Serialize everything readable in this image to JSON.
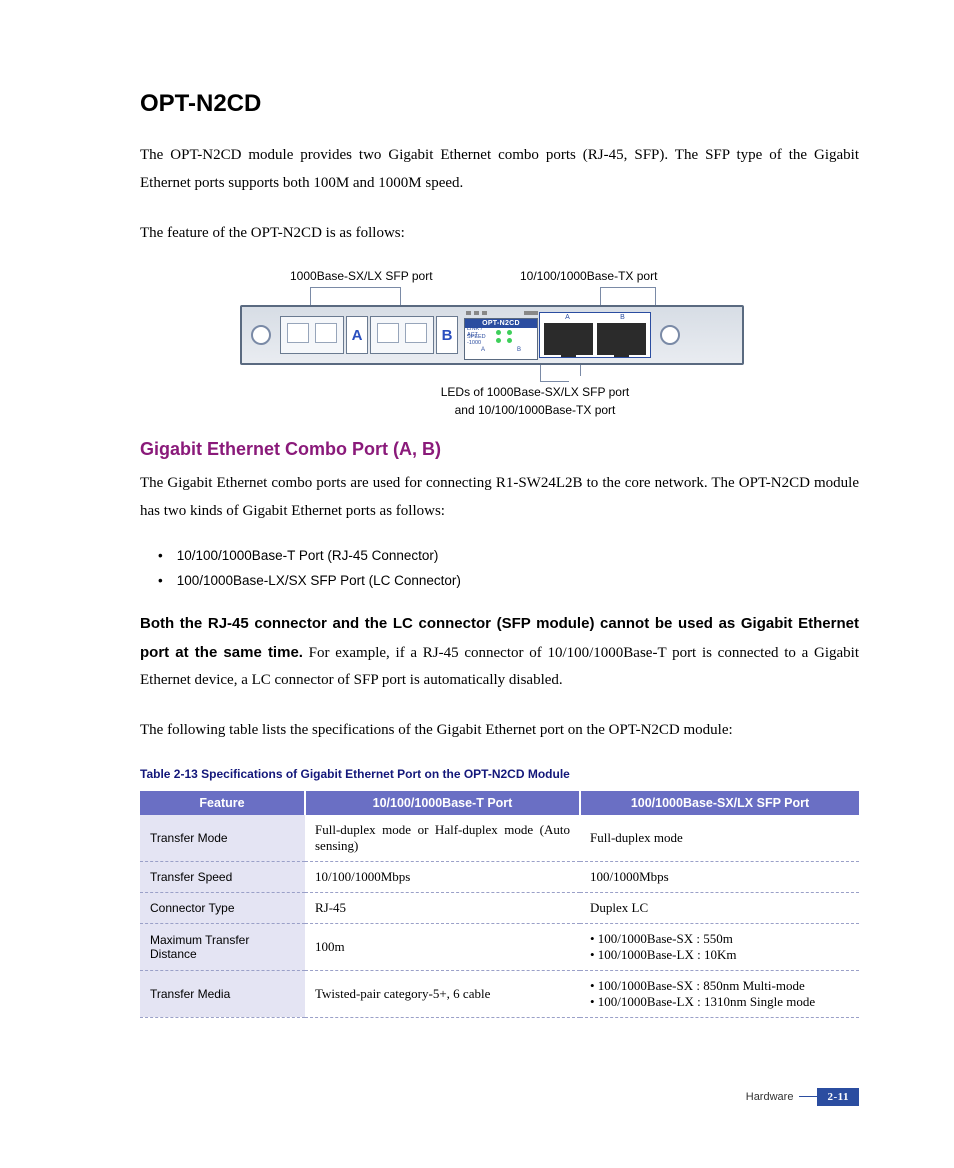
{
  "title": "OPT-N2CD",
  "intro": "The OPT-N2CD module provides two Gigabit Ethernet combo ports (RJ-45, SFP). The SFP type of the Gigabit Ethernet ports supports both 100M and 1000M speed.",
  "feature_line": "The feature of the OPT-N2CD is as follows:",
  "figure": {
    "top_label_left": "1000Base-SX/LX SFP port",
    "top_label_right": "10/100/1000Base-TX port",
    "tag_a": "A",
    "tag_b": "B",
    "led_header": "OPT-N2CD",
    "led_row1": "LINK / ACT",
    "led_row2": "SPEED -1000",
    "led_a": "A",
    "led_b": "B",
    "rj_a": "A",
    "rj_b": "B",
    "bottom_label_1": "LEDs of 1000Base-SX/LX SFP port",
    "bottom_label_2": "and    10/100/1000Base-TX port"
  },
  "sub_heading": "Gigabit Ethernet Combo Port (A, B)",
  "sub_body": "The Gigabit Ethernet combo ports are used for connecting R1-SW24L2B to the core network. The OPT-N2CD module has two kinds of Gigabit Ethernet ports as follows:",
  "bullets": [
    "10/100/1000Base-T Port (RJ-45 Connector)",
    "100/1000Base-LX/SX SFP Port (LC Connector)"
  ],
  "warn_bold": "Both the RJ-45 connector and the LC connector (SFP module) cannot be used as Gigabit Ethernet port at the same time.",
  "warn_rest": " For example, if a RJ-45 connector of 10/100/1000Base-T port is connected to a Gigabit Ethernet device, a LC connector of SFP port is automatically disabled.",
  "table_intro": "The following table lists the specifications of the Gigabit Ethernet port on the OPT-N2CD module:",
  "table_title": "Table 2-13    Specifications of Gigabit Ethernet Port on the OPT-N2CD Module",
  "table": {
    "headers": [
      "Feature",
      "10/100/1000Base-T Port",
      "100/1000Base-SX/LX SFP Port"
    ],
    "rows": [
      {
        "feature": "Transfer Mode",
        "col1": "Full-duplex mode or Half-duplex mode (Auto sensing)",
        "col2": "Full-duplex mode"
      },
      {
        "feature": "Transfer Speed",
        "col1": "10/100/1000Mbps",
        "col2": "100/1000Mbps"
      },
      {
        "feature": "Connector Type",
        "col1": "RJ-45",
        "col2": "Duplex LC"
      },
      {
        "feature": "Maximum Transfer Distance",
        "col1": "100m",
        "col2": "• 100/1000Base-SX : 550m\n• 100/1000Base-LX : 10Km"
      },
      {
        "feature": "Transfer Media",
        "col1": "Twisted-pair category-5+, 6 cable",
        "col2": "• 100/1000Base-SX : 850nm Multi-mode\n• 100/1000Base-LX : 1310nm Single mode"
      }
    ]
  },
  "footer": {
    "section": "Hardware",
    "page": "2-11"
  }
}
